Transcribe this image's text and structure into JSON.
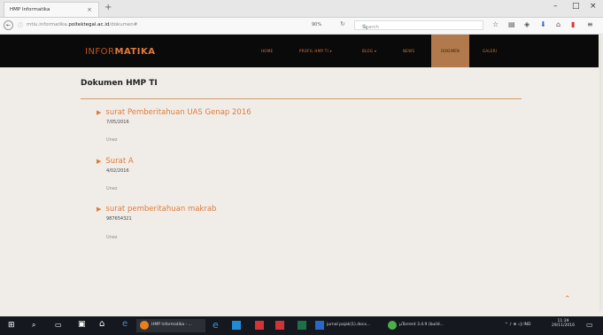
{
  "browser": {
    "tab_title": "HMP Informatika",
    "tab_close": "×",
    "new_tab": "+",
    "win_min": "–",
    "win_max": "□",
    "win_close": "×",
    "back": "←",
    "info": "ⓘ",
    "url_pre": "mtiu.informatika.",
    "url_host": "poltektegal.ac.id",
    "url_path": "/dokumen#",
    "zoom": "90%",
    "reload": "↻",
    "search_placeholder": "Search",
    "search_icon": "🔍"
  },
  "site": {
    "logo_light": "INFOR",
    "logo_bold": "MATIKA",
    "menu": [
      "HOME",
      "PROFIL HMP TI ▾",
      "BLOG ▾",
      "NEWS",
      "DOKUMEN",
      "GALERI"
    ],
    "active": "DOKUMEN"
  },
  "content": {
    "title": "Dokumen HMP TI",
    "documents": [
      {
        "arrow": "▶",
        "title": "surat Pemberitahuan UAS Genap 2016",
        "date": "7/05/2016",
        "link": "Unez"
      },
      {
        "arrow": "▶",
        "title": "Surat A",
        "date": "4/02/2016",
        "link": "Unez"
      },
      {
        "arrow": "▶",
        "title": "surat pemberitahuan makrab",
        "date": "987654321",
        "link": "Unez"
      }
    ],
    "scroll_top": "⌃"
  },
  "taskbar": {
    "items": [
      {
        "label": "HMP Informatika - ...",
        "color": "#e8801a"
      },
      {
        "label": "jurnal pajak(1).docx...",
        "color": "#2b67c6"
      },
      {
        "label": "µTorrent 3.4.9 (build...",
        "color": "#4bb04b"
      }
    ],
    "tray": "^ ♪ ⊕ ◁) IND",
    "time": "11:39",
    "date": "29/11/2016"
  },
  "colors": {
    "accent": "#e07a3a",
    "active_menu": "#b27a4c",
    "header_bg": "#0a0a0a",
    "page_bg": "#f0ede8"
  }
}
